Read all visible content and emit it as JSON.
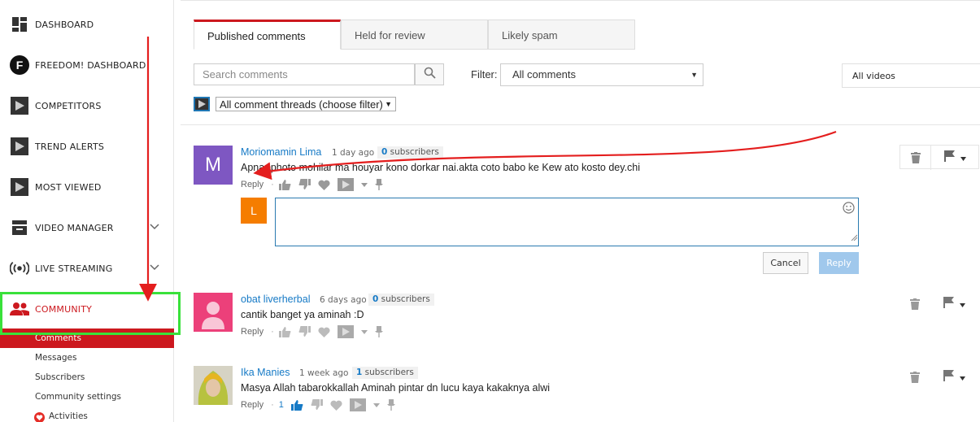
{
  "colors": {
    "brand_red": "#cc181e",
    "link_blue": "#167ac6",
    "highlight_green": "#39e13a",
    "annotation_red": "#e41e1e"
  },
  "sidebar": {
    "items": [
      {
        "label": "DASHBOARD",
        "icon": "dashboard-icon"
      },
      {
        "label": "FREEDOM! DASHBOARD",
        "icon": "freedom-logo-icon"
      },
      {
        "label": "COMPETITORS",
        "icon": "tubebuddy-icon"
      },
      {
        "label": "TREND ALERTS",
        "icon": "tubebuddy-icon"
      },
      {
        "label": "MOST VIEWED",
        "icon": "tubebuddy-icon"
      },
      {
        "label": "VIDEO MANAGER",
        "icon": "video-manager-icon"
      },
      {
        "label": "LIVE STREAMING",
        "icon": "live-streaming-icon"
      },
      {
        "label": "COMMUNITY",
        "icon": "community-icon"
      }
    ],
    "subitems": [
      {
        "label": "Comments"
      },
      {
        "label": "Messages"
      },
      {
        "label": "Subscribers"
      },
      {
        "label": "Community settings"
      },
      {
        "label": "Activities"
      }
    ]
  },
  "tabs": [
    {
      "label": "Published comments",
      "active": true
    },
    {
      "label": "Held for review"
    },
    {
      "label": "Likely spam"
    }
  ],
  "search": {
    "placeholder": "Search comments"
  },
  "filter": {
    "label": "Filter:",
    "value": "All comments"
  },
  "videos_select": {
    "value": "All videos"
  },
  "thread_filter": {
    "value": "All comment threads (choose filter)"
  },
  "comments": [
    {
      "author": "Moriomamin Lima",
      "time": "1 day ago",
      "subs_count": "0",
      "subs_label": "subscribers",
      "text": "Apnar photo mohilar ma houyar kono dorkar nai.akta coto babo ke Kew ato kosto dey.chi",
      "reply_label": "Reply",
      "avatar_letter": "M",
      "avatar_color": "#7e57c2"
    },
    {
      "author": "obat liverherbal",
      "time": "6 days ago",
      "subs_count": "0",
      "subs_label": "subscribers",
      "text": "cantik banget ya aminah :D",
      "reply_label": "Reply",
      "avatar_color": "#ec407a"
    },
    {
      "author": "Ika Manies",
      "time": "1 week ago",
      "subs_count": "1",
      "subs_label": "subscribers",
      "text": "Masya Allah tabarokkallah Aminah pintar dn lucu kaya kakaknya alwi",
      "reply_label": "Reply",
      "likes": "1"
    }
  ],
  "reply_form": {
    "avatar_letter": "L",
    "cancel_label": "Cancel",
    "reply_label": "Reply"
  }
}
